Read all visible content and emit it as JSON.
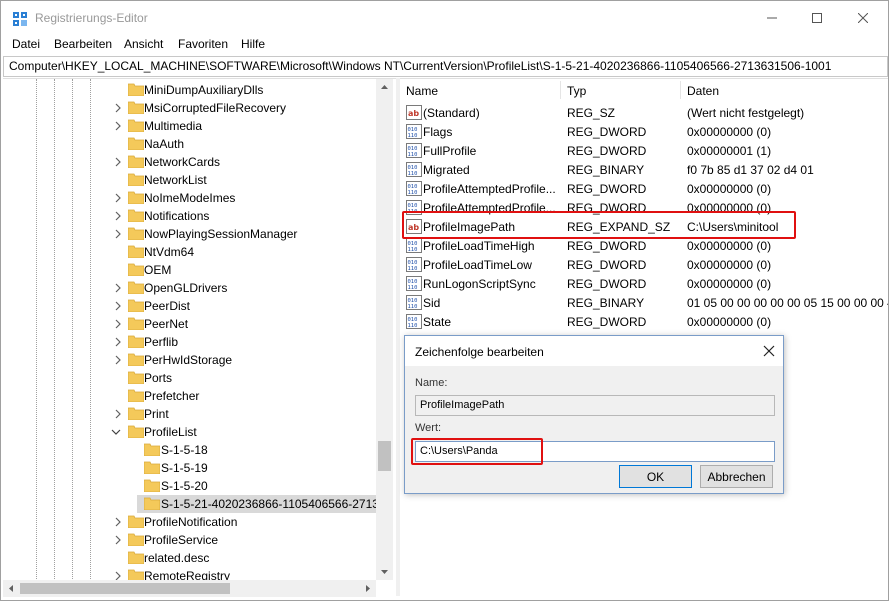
{
  "window": {
    "title": "Registrierungs-Editor"
  },
  "menu": [
    "Datei",
    "Bearbeiten",
    "Ansicht",
    "Favoriten",
    "Hilfe"
  ],
  "address": "Computer\\HKEY_LOCAL_MACHINE\\SOFTWARE\\Microsoft\\Windows NT\\CurrentVersion\\ProfileList\\S-1-5-21-4020236866-1105406566-2713631506-1001",
  "tree": {
    "items": [
      "MiniDumpAuxiliaryDlls",
      "MsiCorruptedFileRecovery",
      "Multimedia",
      "NaAuth",
      "NetworkCards",
      "NetworkList",
      "NoImeModeImes",
      "Notifications",
      "NowPlayingSessionManager",
      "NtVdm64",
      "OEM",
      "OpenGLDrivers",
      "PeerDist",
      "PeerNet",
      "Perflib",
      "PerHwIdStorage",
      "Ports",
      "Prefetcher",
      "Print",
      "ProfileList",
      "S-1-5-18",
      "S-1-5-19",
      "S-1-5-20",
      "S-1-5-21-4020236866-1105406566-271363",
      "ProfileNotification",
      "ProfileService",
      "related.desc",
      "RemoteRegistry"
    ]
  },
  "list": {
    "headers": {
      "name": "Name",
      "type": "Typ",
      "data": "Daten"
    },
    "rows": [
      {
        "name": "(Standard)",
        "type": "REG_SZ",
        "data": "(Wert nicht festgelegt)",
        "icon": "string-value-icon"
      },
      {
        "name": "Flags",
        "type": "REG_DWORD",
        "data": "0x00000000 (0)",
        "icon": "binary-value-icon"
      },
      {
        "name": "FullProfile",
        "type": "REG_DWORD",
        "data": "0x00000001 (1)",
        "icon": "binary-value-icon"
      },
      {
        "name": "Migrated",
        "type": "REG_BINARY",
        "data": "f0 7b 85 d1 37 02 d4 01",
        "icon": "binary-value-icon"
      },
      {
        "name": "ProfileAttemptedProfile...",
        "type": "REG_DWORD",
        "data": "0x00000000 (0)",
        "icon": "binary-value-icon"
      },
      {
        "name": "ProfileAttemptedProfile...",
        "type": "REG_DWORD",
        "data": "0x00000000 (0)",
        "icon": "binary-value-icon"
      },
      {
        "name": "ProfileImagePath",
        "type": "REG_EXPAND_SZ",
        "data": "C:\\Users\\minitool",
        "icon": "string-value-icon"
      },
      {
        "name": "ProfileLoadTimeHigh",
        "type": "REG_DWORD",
        "data": "0x00000000 (0)",
        "icon": "binary-value-icon"
      },
      {
        "name": "ProfileLoadTimeLow",
        "type": "REG_DWORD",
        "data": "0x00000000 (0)",
        "icon": "binary-value-icon"
      },
      {
        "name": "RunLogonScriptSync",
        "type": "REG_DWORD",
        "data": "0x00000000 (0)",
        "icon": "binary-value-icon"
      },
      {
        "name": "Sid",
        "type": "REG_BINARY",
        "data": "01 05 00 00 00 00 00 05 15 00 00 00 42 1",
        "icon": "binary-value-icon"
      },
      {
        "name": "State",
        "type": "REG_DWORD",
        "data": "0x00000000 (0)",
        "icon": "binary-value-icon"
      }
    ]
  },
  "dialog": {
    "title": "Zeichenfolge bearbeiten",
    "name_label": "Name:",
    "name_value": "ProfileImagePath",
    "value_label": "Wert:",
    "value_value": "C:\\Users\\Panda",
    "ok": "OK",
    "cancel": "Abbrechen"
  },
  "colors": {
    "highlight": "#e01010",
    "folder": "#f4c95a",
    "selection": "#d9d9d9"
  }
}
